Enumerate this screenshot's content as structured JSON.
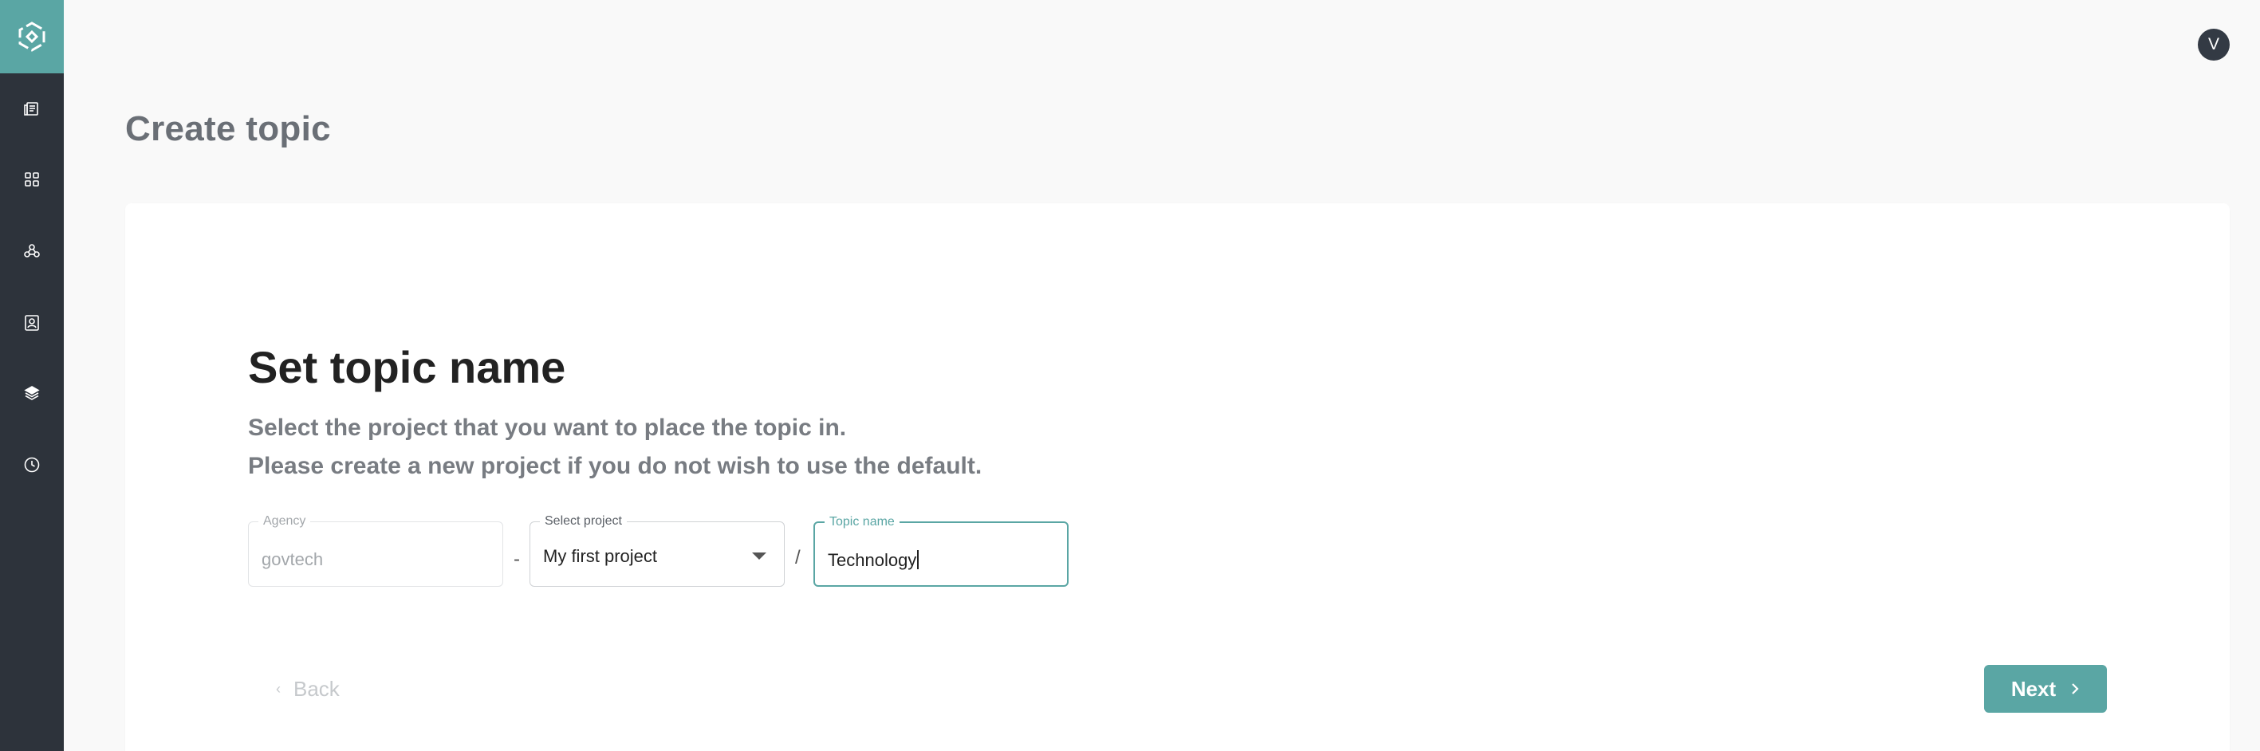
{
  "header": {
    "avatar_initial": "V"
  },
  "sidebar": {
    "items": [
      {
        "icon": "catalog-icon"
      },
      {
        "icon": "dashboard-grid-icon"
      },
      {
        "icon": "network-nodes-icon"
      },
      {
        "icon": "contacts-icon"
      },
      {
        "icon": "layers-icon"
      },
      {
        "icon": "clock-icon"
      }
    ],
    "accent": "#5aa6a4",
    "background": "#2d333b"
  },
  "page": {
    "title": "Create topic"
  },
  "form": {
    "heading": "Set topic name",
    "description_line1": "Select the project that you want to place the topic in.",
    "description_line2": "Please create a new project if you do not wish to use the default.",
    "agency": {
      "label": "Agency",
      "value": "govtech"
    },
    "separator_dash": "-",
    "project": {
      "label": "Select project",
      "value": "My first project"
    },
    "separator_slash": "/",
    "topic_name": {
      "label": "Topic name",
      "value": "Technology"
    }
  },
  "actions": {
    "back_label": "Back",
    "next_label": "Next"
  }
}
